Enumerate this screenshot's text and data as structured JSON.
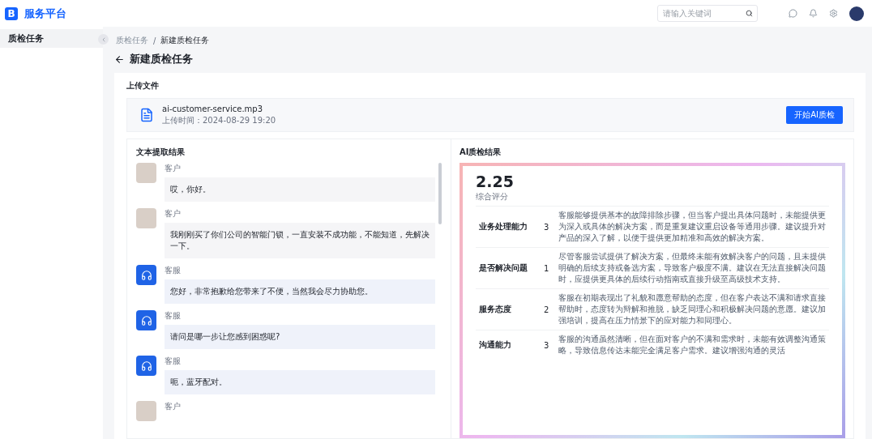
{
  "header": {
    "brand_letter": "B",
    "brand": "服务平台",
    "search": {
      "placeholder": "请输入关键词"
    }
  },
  "sidebar": {
    "items": [
      {
        "label": "质检任务",
        "selected": true
      }
    ]
  },
  "breadcrumb": {
    "separator": "/",
    "items": [
      {
        "label": "质检任务",
        "current": false
      },
      {
        "label": "新建质检任务",
        "current": true
      }
    ]
  },
  "page_title": "新建质检任务",
  "upload": {
    "title": "上传文件",
    "file_name": "ai-customer-service.mp3",
    "upload_time": "上传时间：2024-08-29 19:20",
    "button": "开始AI质检"
  },
  "transcript": {
    "title": "文本提取结果",
    "messages": [
      {
        "kind": "customer",
        "speaker": "客户",
        "text": "哎，你好。"
      },
      {
        "kind": "customer",
        "speaker": "客户",
        "text": "我刚刚买了你们公司的智能门锁，一直安装不成功能，不能知道，先解决一下。"
      },
      {
        "kind": "agent",
        "speaker": "客服",
        "text": "您好，非常抱歉给您带来了不便，当然我会尽力协助您。"
      },
      {
        "kind": "agent",
        "speaker": "客服",
        "text": "请问是哪一步让您感到困惑呢?"
      },
      {
        "kind": "agent",
        "speaker": "客服",
        "text": "呃，蓝牙配对。"
      },
      {
        "kind": "customer",
        "speaker": "客户"
      }
    ]
  },
  "result": {
    "title": "AI质检结果",
    "score": "2.25",
    "score_label": "综合评分",
    "rows": [
      {
        "name": "业务处理能力",
        "score": "3",
        "comment": "客服能够提供基本的故障排除步骤，但当客户提出具体问题时，未能提供更为深入或具体的解决方案，而是重复建议重启设备等通用步骤。建议提升对产品的深入了解，以便于提供更加精准和高效的解决方案。"
      },
      {
        "name": "是否解决问题",
        "score": "1",
        "comment": "尽管客服尝试提供了解决方案，但最终未能有效解决客户的问题，且未提供明确的后续支持或备选方案，导致客户极度不满。建议在无法直接解决问题时，应提供更具体的后续行动指南或直接升级至高级技术支持。"
      },
      {
        "name": "服务态度",
        "score": "2",
        "comment": "客服在初期表现出了礼貌和愿意帮助的态度，但在客户表达不满和请求直接帮助时，态度转为辩解和推脱，缺乏同理心和积极解决问题的意愿。建议加强培训，提高在压力情景下的应对能力和同理心。"
      },
      {
        "name": "沟通能力",
        "score": "3",
        "comment": "客服的沟通虽然清晰，但在面对客户的不满和需求时，未能有效调整沟通策略，导致信息传达未能完全满足客户需求。建议增强沟通的灵活"
      }
    ]
  }
}
